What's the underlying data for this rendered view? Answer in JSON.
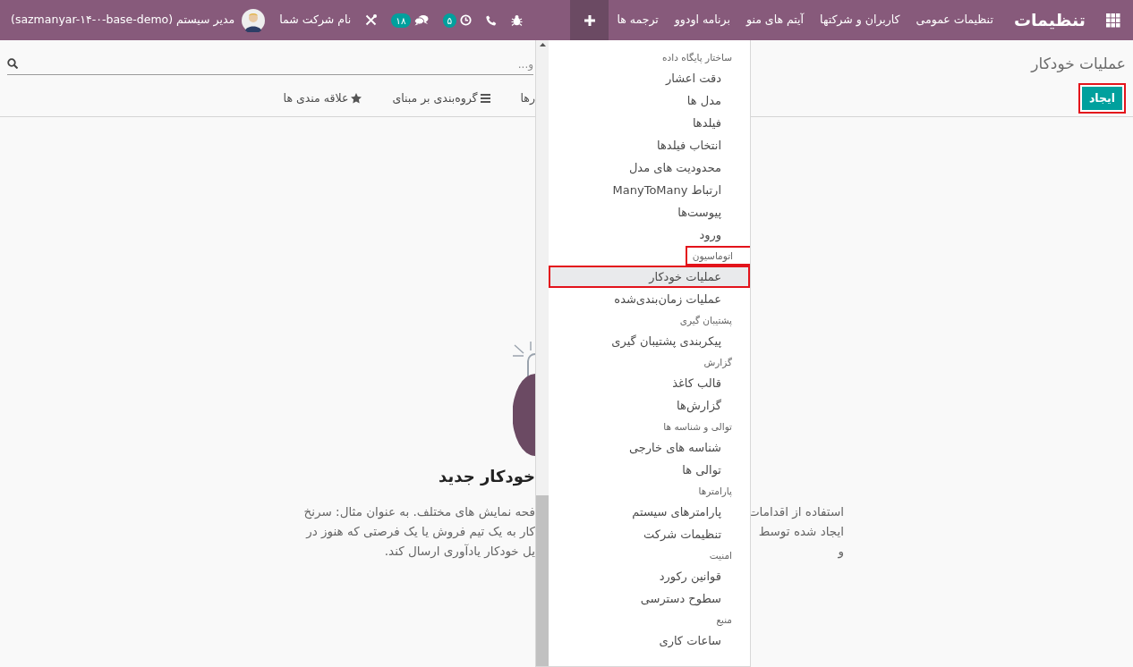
{
  "navbar": {
    "app_title": "تنظیمات",
    "menu": [
      {
        "label": "تنظیمات عمومی"
      },
      {
        "label": "کاربران و شرکتها"
      },
      {
        "label": "آیتم های منو"
      },
      {
        "label": "برنامه اودوو"
      },
      {
        "label": "ترجمه ها"
      }
    ],
    "quick_create": {
      "expanded": true
    },
    "systray": {
      "activities_count": "۵",
      "messages_count": "۱۸",
      "company": "نام شرکت شما",
      "user": "مدیر سیستم (sazmanyar-۱۴-۰-base-demo)"
    }
  },
  "breadcrumb": "عملیات خودکار",
  "search": {
    "placeholder": "و..."
  },
  "create_button": {
    "label": "ایجاد",
    "highlighted": true
  },
  "filters": [
    {
      "label": "رها",
      "kind": "filter"
    },
    {
      "label": "گروه‌بندی بر مبنای",
      "kind": "groupby"
    },
    {
      "label": "علاقه مندی ها",
      "kind": "favorites"
    }
  ],
  "empty_state": {
    "title": "خودکار جدید",
    "lines": [
      {
        "left": "فحه نمایش های مختلف. به عنوان مثال: سرنخ",
        "right": "استفاده از اقدامات"
      },
      {
        "left": "کار به یک تیم فروش یا یک فرصتی که هنوز در",
        "right": "ایجاد شده توسط"
      },
      {
        "left": "یل خودکار یادآوری ارسال کند.",
        "right": "و"
      }
    ]
  },
  "dropdown": {
    "entries": [
      {
        "kind": "header",
        "label": "ساختار پایگاه داده",
        "highlighted": false
      },
      {
        "kind": "item",
        "label": "دقت اعشار",
        "selected": false,
        "highlighted": false
      },
      {
        "kind": "item",
        "label": "مدل ها",
        "selected": false,
        "highlighted": false
      },
      {
        "kind": "item",
        "label": "فیلدها",
        "selected": false,
        "highlighted": false
      },
      {
        "kind": "item",
        "label": "انتخاب فیلدها",
        "selected": false,
        "highlighted": false
      },
      {
        "kind": "item",
        "label": "محدودیت های مدل",
        "selected": false,
        "highlighted": false
      },
      {
        "kind": "item",
        "label": "ارتباط ManyToMany",
        "selected": false,
        "highlighted": false
      },
      {
        "kind": "item",
        "label": "پیوست‌ها",
        "selected": false,
        "highlighted": false
      },
      {
        "kind": "item",
        "label": "ورود",
        "selected": false,
        "highlighted": false
      },
      {
        "kind": "header",
        "label": "اتوماسیون",
        "highlighted": true
      },
      {
        "kind": "item",
        "label": "عملیات خودکار",
        "selected": true,
        "highlighted": true
      },
      {
        "kind": "item",
        "label": "عملیات زمان‌بندی‌شده",
        "selected": false,
        "highlighted": false
      },
      {
        "kind": "header",
        "label": "پشتیبان گیری",
        "highlighted": false
      },
      {
        "kind": "item",
        "label": "پیکربندی پشتیبان گیری",
        "selected": false,
        "highlighted": false
      },
      {
        "kind": "header",
        "label": "گزارش",
        "highlighted": false
      },
      {
        "kind": "item",
        "label": "قالب کاغذ",
        "selected": false,
        "highlighted": false
      },
      {
        "kind": "item",
        "label": "گزارش‌ها",
        "selected": false,
        "highlighted": false
      },
      {
        "kind": "header",
        "label": "توالی و شناسه ها",
        "highlighted": false
      },
      {
        "kind": "item",
        "label": "شناسه های خارجی",
        "selected": false,
        "highlighted": false
      },
      {
        "kind": "item",
        "label": "توالی ها",
        "selected": false,
        "highlighted": false
      },
      {
        "kind": "header",
        "label": "پارامترها",
        "highlighted": false
      },
      {
        "kind": "item",
        "label": "پارامترهای سیستم",
        "selected": false,
        "highlighted": false
      },
      {
        "kind": "item",
        "label": "تنظیمات شرکت",
        "selected": false,
        "highlighted": false
      },
      {
        "kind": "header",
        "label": "امنیت",
        "highlighted": false
      },
      {
        "kind": "item",
        "label": "قوانین رکورد",
        "selected": false,
        "highlighted": false
      },
      {
        "kind": "item",
        "label": "سطوح دسترسی",
        "selected": false,
        "highlighted": false
      },
      {
        "kind": "header",
        "label": "منبع",
        "highlighted": false
      },
      {
        "kind": "item",
        "label": "ساعات کاری",
        "selected": false,
        "highlighted": false
      }
    ]
  }
}
